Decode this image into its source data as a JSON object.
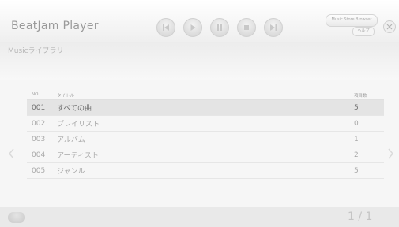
{
  "app": {
    "title": "BeatJam Player"
  },
  "toolbar": {
    "buttons": [
      {
        "name": "previous-button",
        "icon": "previous-icon"
      },
      {
        "name": "play-button",
        "icon": "play-icon"
      },
      {
        "name": "pause-button",
        "icon": "pause-icon"
      },
      {
        "name": "stop-button",
        "icon": "stop-icon"
      },
      {
        "name": "next-button",
        "icon": "next-icon"
      }
    ],
    "browser_label": "Music Store Browser",
    "help_label": "ヘルプ",
    "close_icon": "close-icon"
  },
  "section": {
    "title": "Musicライブラリ"
  },
  "table": {
    "headers": {
      "no": "NO",
      "title": "タイトル",
      "count": "項目数"
    },
    "rows": [
      {
        "no": "001",
        "title": "すべての曲",
        "count": "5",
        "selected": true
      },
      {
        "no": "002",
        "title": "プレイリスト",
        "count": "0",
        "selected": false
      },
      {
        "no": "003",
        "title": "アルバム",
        "count": "1",
        "selected": false
      },
      {
        "no": "004",
        "title": "アーティスト",
        "count": "2",
        "selected": false
      },
      {
        "no": "005",
        "title": "ジャンル",
        "count": "5",
        "selected": false
      }
    ]
  },
  "footer": {
    "pager": "1 / 1"
  },
  "colors": {
    "background": "#f6f6f6",
    "selected_row": "#e4e4e4",
    "text": "#a8a8a8"
  }
}
